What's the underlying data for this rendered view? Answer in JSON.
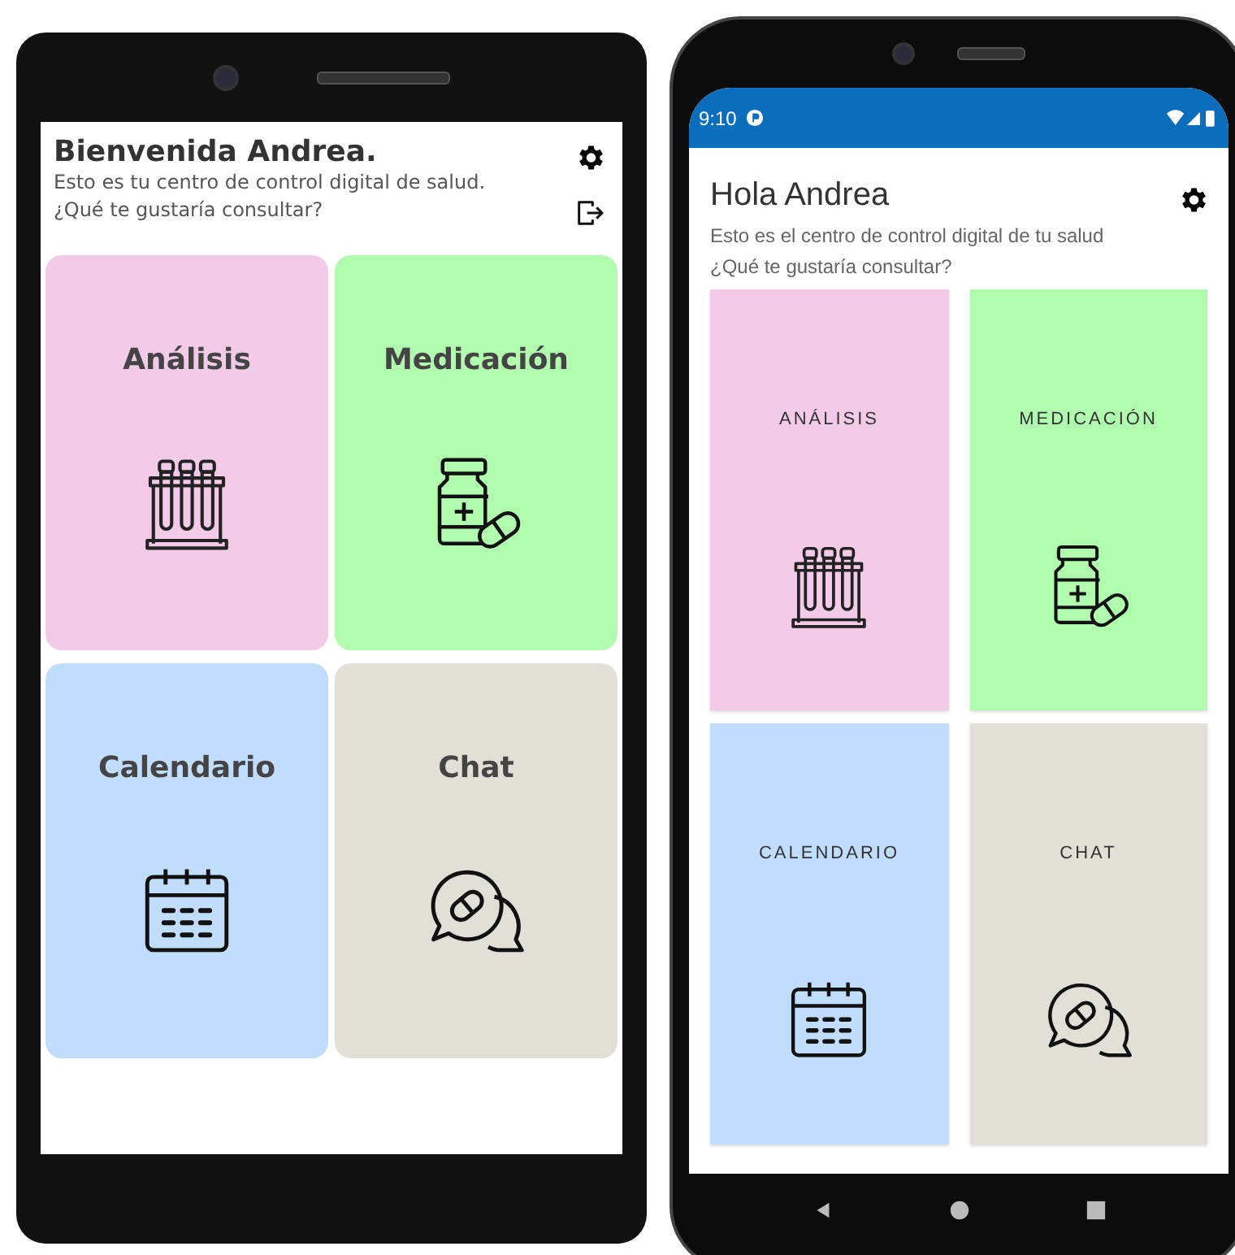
{
  "phones": [
    {
      "kind": "flat",
      "header": {
        "title": "Bienvenida Andrea.",
        "subtitle": "Esto es tu centro de control digital de salud.",
        "prompt": "¿Qué te gustaría consultar?",
        "icons": [
          {
            "kind": "settings"
          },
          {
            "kind": "logout"
          }
        ]
      },
      "tiles": [
        {
          "label": "Análisis",
          "kind": "analysis",
          "color": "#f3cbe8"
        },
        {
          "label": "Medicación",
          "kind": "medication",
          "color": "#b1fbaf"
        },
        {
          "label": "Calendario",
          "kind": "calendar",
          "color": "#c1ddfd"
        },
        {
          "label": "Chat",
          "kind": "chat",
          "color": "#e2dfd7"
        }
      ]
    },
    {
      "kind": "android",
      "status_bar": {
        "time": "9:10"
      },
      "header": {
        "title": "Hola Andrea",
        "subtitle": "Esto es el centro de control digital de tu salud",
        "prompt": "¿Qué te gustaría consultar?",
        "icons": [
          {
            "kind": "settings"
          }
        ]
      },
      "tiles": [
        {
          "label": "ANÁLISIS",
          "kind": "analysis",
          "color": "#f3cbe8"
        },
        {
          "label": "MEDICACIÓN",
          "kind": "medication",
          "color": "#b1fbaf"
        },
        {
          "label": "CALENDARIO",
          "kind": "calendar",
          "color": "#c1ddfd"
        },
        {
          "label": "CHAT",
          "kind": "chat",
          "color": "#e2dfd7"
        }
      ]
    }
  ]
}
